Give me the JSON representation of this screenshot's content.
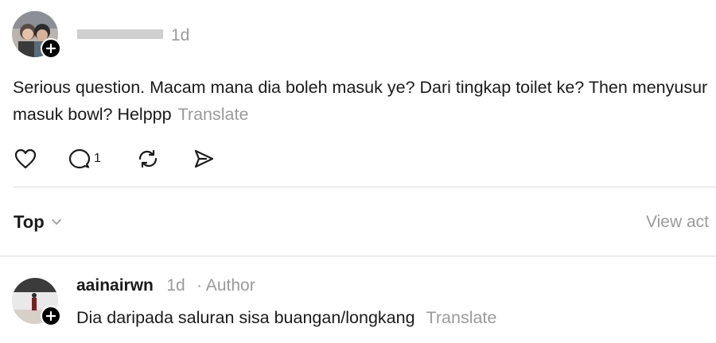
{
  "post": {
    "time": "1d",
    "text": "Serious question. Macam mana dia boleh masuk ye? Dari tingkap toilet ke? Then menyusur masuk bowl? Helppp",
    "translate_label": "Translate",
    "reply_count": "1",
    "avatar_icon": "avatar-photo",
    "follow_icon": "plus-icon"
  },
  "actions": {
    "like_icon": "heart-icon",
    "reply_icon": "comment-icon",
    "repost_icon": "repost-icon",
    "share_icon": "send-icon"
  },
  "sort": {
    "label": "Top",
    "icon": "chevron-down-icon",
    "view_activity_label": "View act"
  },
  "reply": {
    "username": "aainairwn",
    "time": "1d",
    "author_tag": "· Author",
    "text": "Dia daripada saluran sisa buangan/longkang",
    "translate_label": "Translate"
  },
  "colors": {
    "text": "#1a1a1a",
    "muted": "#9a9a9a",
    "divider": "#dcdcdc"
  }
}
